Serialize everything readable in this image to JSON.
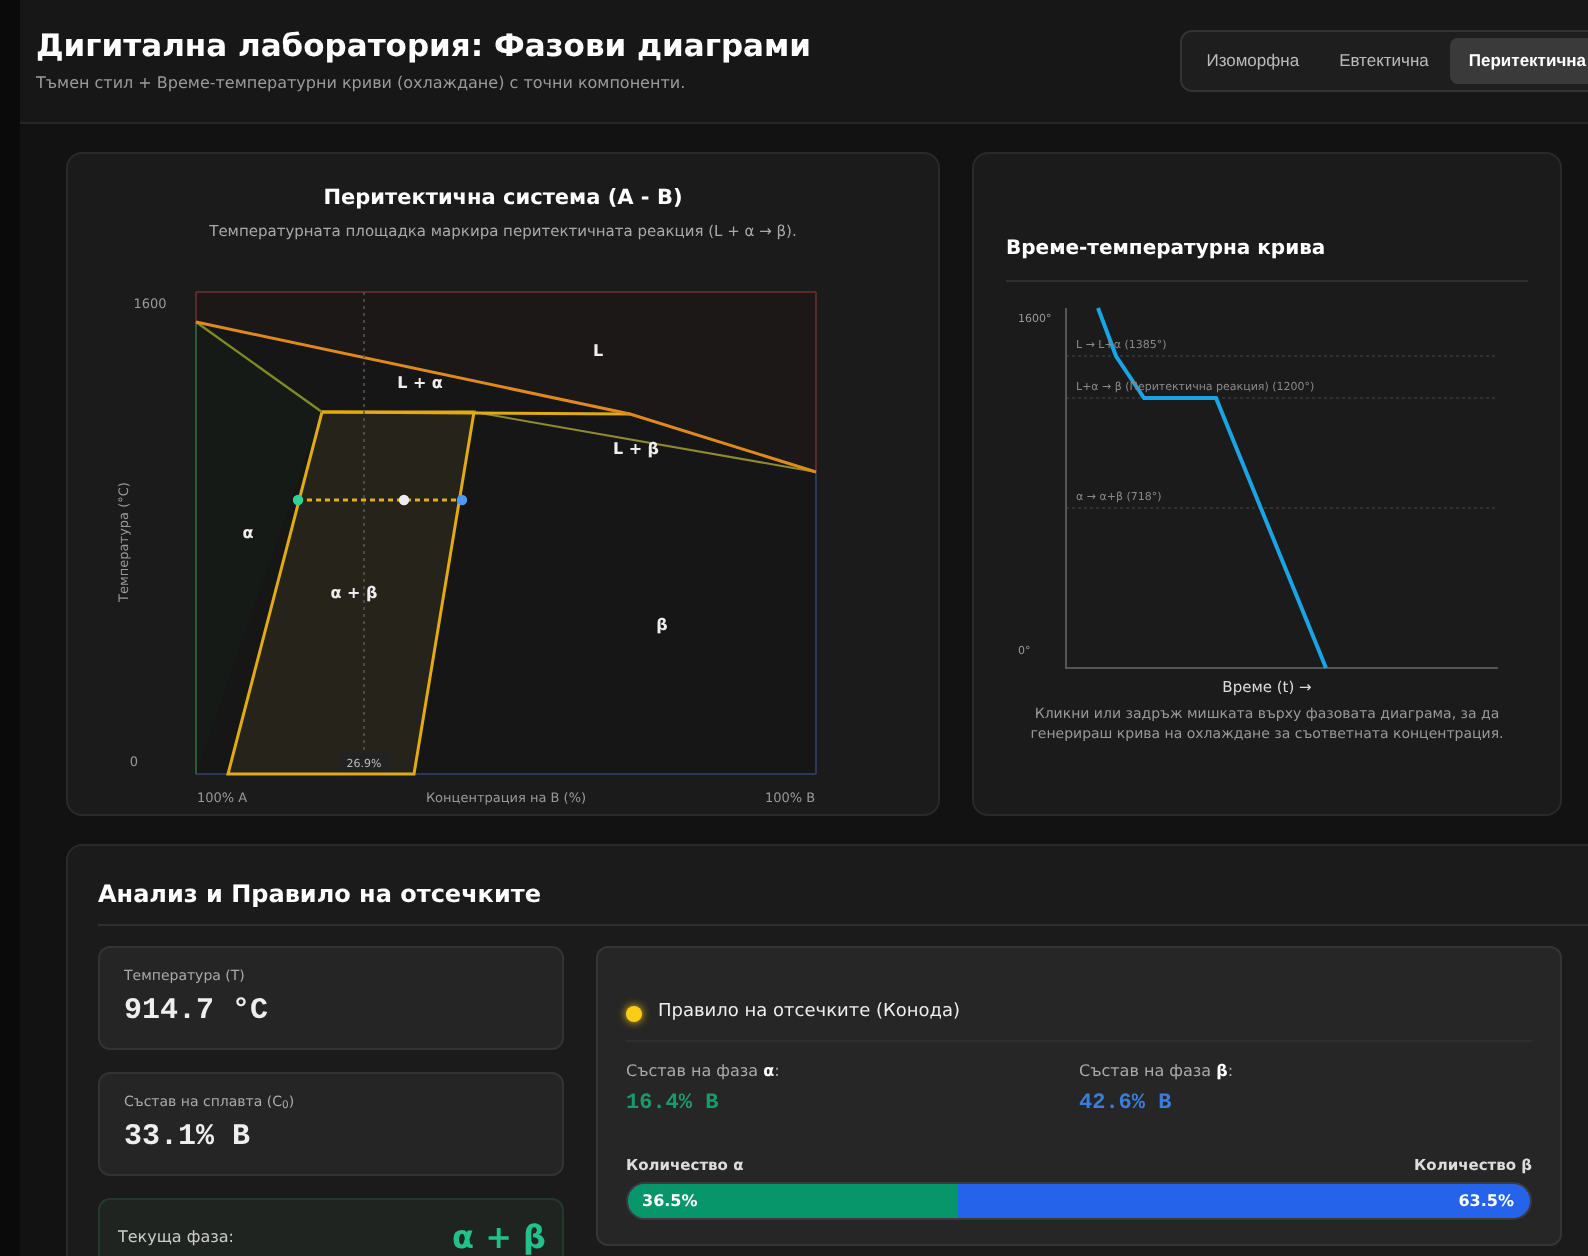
{
  "header": {
    "title": "Дигитална лаборатория: Фазови диаграми",
    "subtitle": "Тъмен стил + Време-температурни криви (охлаждане) с точни компоненти."
  },
  "tabs": [
    {
      "label": "Изоморфна",
      "selected": false
    },
    {
      "label": "Евтектична",
      "selected": false
    },
    {
      "label": "Перитектична",
      "selected": true
    }
  ],
  "phase_diagram": {
    "title": "Перитектична система (A - B)",
    "subtitle": "Температурната площадка маркира перитектичната реакция (L + α → β).",
    "y_max": "1600",
    "y_min": "0",
    "y_label": "Температура (°C)",
    "x_left": "100% A",
    "x_label": "Концентрация на В (%)",
    "x_right": "100% B",
    "marker": "26.9%",
    "regions": [
      {
        "label": "L"
      },
      {
        "label": "L + α"
      },
      {
        "label": "L + β"
      },
      {
        "label": "α"
      },
      {
        "label": "α + β"
      },
      {
        "label": "β"
      }
    ]
  },
  "cooling_curve": {
    "title": "Време-температурна крива",
    "y_max": "1600°",
    "y_min": "0°",
    "x_label": "Време (t) →",
    "caption": "Кликни или задръж мишката върху фазовата диаграма, за да генерираш крива на охлаждане за съответната концентрация.",
    "annotations": [
      "L → L+α (1385°)",
      "L+α → β (Перитектична реакция) (1200°)",
      "α → α+β (718°)"
    ]
  },
  "analysis": {
    "title": "Анализ и Правило на отсечките",
    "temperature": {
      "label": "Температура (T)",
      "value": "914.7 °C"
    },
    "composition": {
      "label": "Състав на сплавта (C$_{0}$)",
      "value": "33.1% B"
    },
    "phase": {
      "label": "Текуща фаза:",
      "value": "α + β"
    },
    "lever": {
      "title": "Правило на отсечките (Конода)",
      "alpha": {
        "label": "Състав на фаза **α**:",
        "value": "16.4% B"
      },
      "beta": {
        "label": "Състав на фаза **β**:",
        "value": "42.6% B"
      },
      "alpha_amount": {
        "label": "Количество α",
        "share": "36.5%",
        "level": 0.365
      },
      "beta_amount": {
        "label": "Количество β",
        "share": "63.5%"
      }
    }
  }
}
